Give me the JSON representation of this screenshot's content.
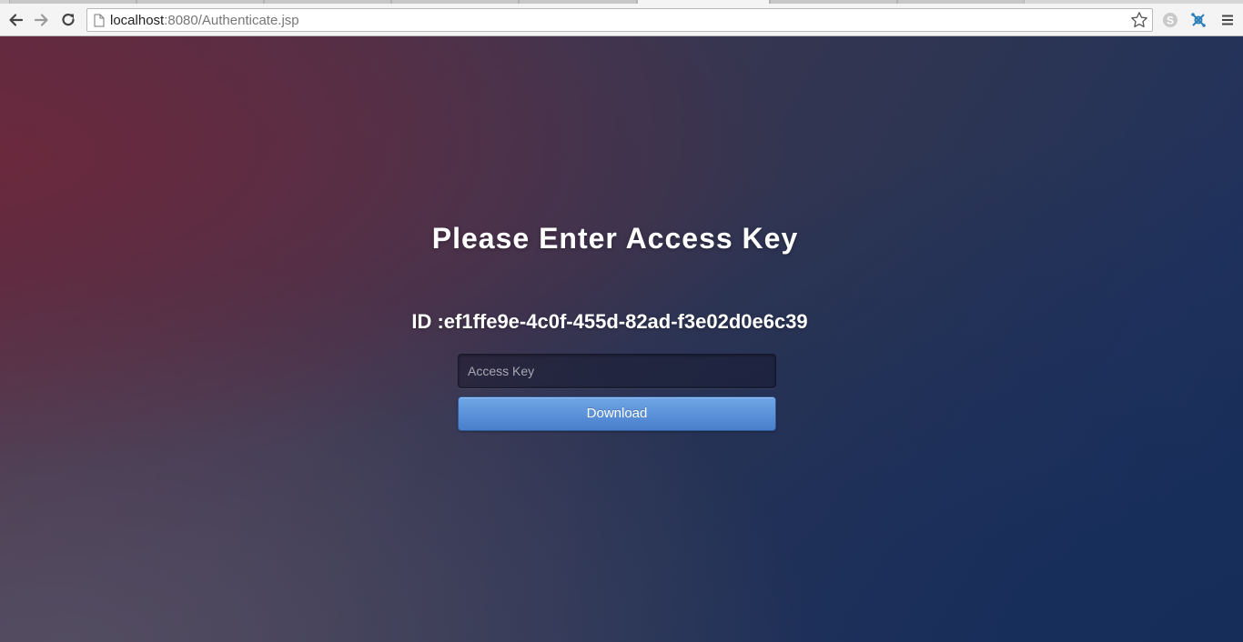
{
  "browser": {
    "url_host": "localhost",
    "url_rest": ":8080/Authenticate.jsp",
    "icons": [
      "back-icon",
      "forward-icon",
      "reload-icon",
      "page-icon",
      "bookmark-star-icon",
      "skype-extension-icon",
      "network-extension-icon",
      "menu-icon"
    ]
  },
  "page": {
    "title": "Please Enter Access Key",
    "id_text": "ID :ef1ffe9e-4c0f-455d-82ad-f3e02d0e6c39",
    "access_key": {
      "placeholder": "Access Key",
      "value": ""
    },
    "download_label": "Download"
  },
  "colors": {
    "button_top": "#6ea6e6",
    "button_bottom": "#4a7fcc",
    "background_left": "#5a2d42",
    "background_right": "#1a2e58"
  }
}
